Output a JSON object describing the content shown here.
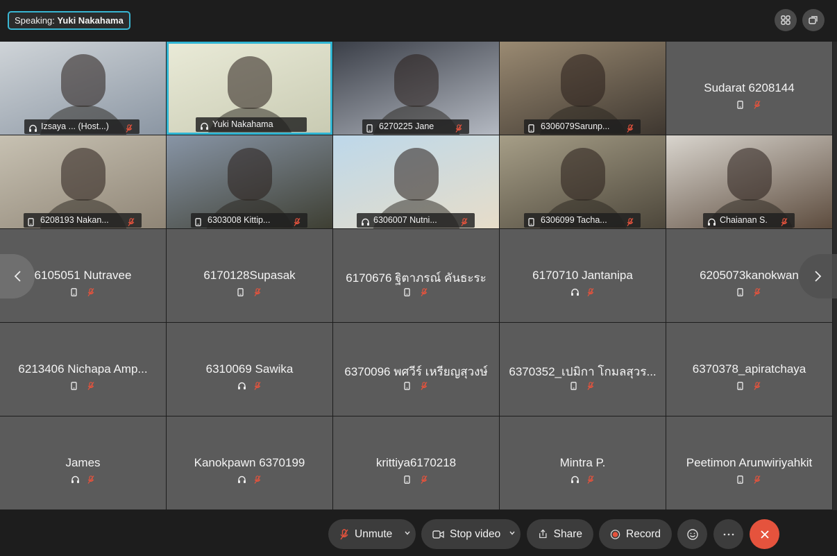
{
  "speaking": {
    "prefix": "Speaking:",
    "name": "Yuki Nakahama"
  },
  "grid": {
    "video_tiles": [
      {
        "label": "Izsaya ... (Host...)",
        "device": "headset",
        "muted": true,
        "bg": [
          "#cfd4d8",
          "#8b96a3"
        ]
      },
      {
        "label": "Yuki Nakahama",
        "device": "headset",
        "muted": false,
        "bg": [
          "#e9ead7",
          "#c9cbb3"
        ],
        "active": true
      },
      {
        "label": "6270225 Jane",
        "device": "phone",
        "muted": true,
        "bg": [
          "#3b3f48",
          "#b4b9c2"
        ]
      },
      {
        "label": "6306079Sarunp...",
        "device": "phone",
        "muted": true,
        "bg": [
          "#9a8a72",
          "#3e3730"
        ]
      },
      {
        "label": "6208193 Nakan...",
        "device": "phone",
        "muted": true,
        "bg": [
          "#c7c1b2",
          "#8f8576"
        ]
      },
      {
        "label": "6303008 Kittip...",
        "device": "phone",
        "muted": true,
        "bg": [
          "#8895a6",
          "#3e3f33"
        ]
      },
      {
        "label": "6306007 Nutni...",
        "device": "headset",
        "muted": true,
        "bg": [
          "#bdd8ea",
          "#e7ddc9"
        ]
      },
      {
        "label": "6306099 Tacha...",
        "device": "phone",
        "muted": true,
        "bg": [
          "#a69e87",
          "#4d473b"
        ]
      },
      {
        "label": "Chaianan S.",
        "device": "headset",
        "muted": true,
        "bg": [
          "#d9d5ce",
          "#5d4c3e"
        ]
      }
    ],
    "audio_tiles": [
      {
        "name": "Sudarat 6208144",
        "device": "phone"
      },
      {
        "name": "6105051 Nutravee",
        "device": "phone"
      },
      {
        "name": "6170128Supasak",
        "device": "phone"
      },
      {
        "name": "6170676 ฐิตาภรณ์ คันธะระ",
        "device": "phone"
      },
      {
        "name": "6170710 Jantanipa",
        "device": "headset"
      },
      {
        "name": "6205073kanokwan",
        "device": "phone"
      },
      {
        "name": "6213406 Nichapa Amp...",
        "device": "phone"
      },
      {
        "name": "6310069 Sawika",
        "device": "headset"
      },
      {
        "name": "6370096 พศวีร์ เหรียญสุวงษ์",
        "device": "phone"
      },
      {
        "name": "6370352_เปมิกา โกมลสุวร...",
        "device": "phone"
      },
      {
        "name": "6370378_apiratchaya",
        "device": "phone"
      },
      {
        "name": "James",
        "device": "headset"
      },
      {
        "name": "Kanokpawn 6370199",
        "device": "headset"
      },
      {
        "name": "krittiya6170218",
        "device": "phone"
      },
      {
        "name": "Mintra P.",
        "device": "headset"
      },
      {
        "name": "Peetimon Arunwiriyahkit",
        "device": "phone"
      }
    ]
  },
  "controls": {
    "unmute": "Unmute",
    "stop_video": "Stop video",
    "share": "Share",
    "record": "Record"
  },
  "colors": {
    "accent": "#30b5d3",
    "muted_icon": "#e5533d",
    "end": "#e5533d",
    "tile": "#5b5b5b"
  }
}
